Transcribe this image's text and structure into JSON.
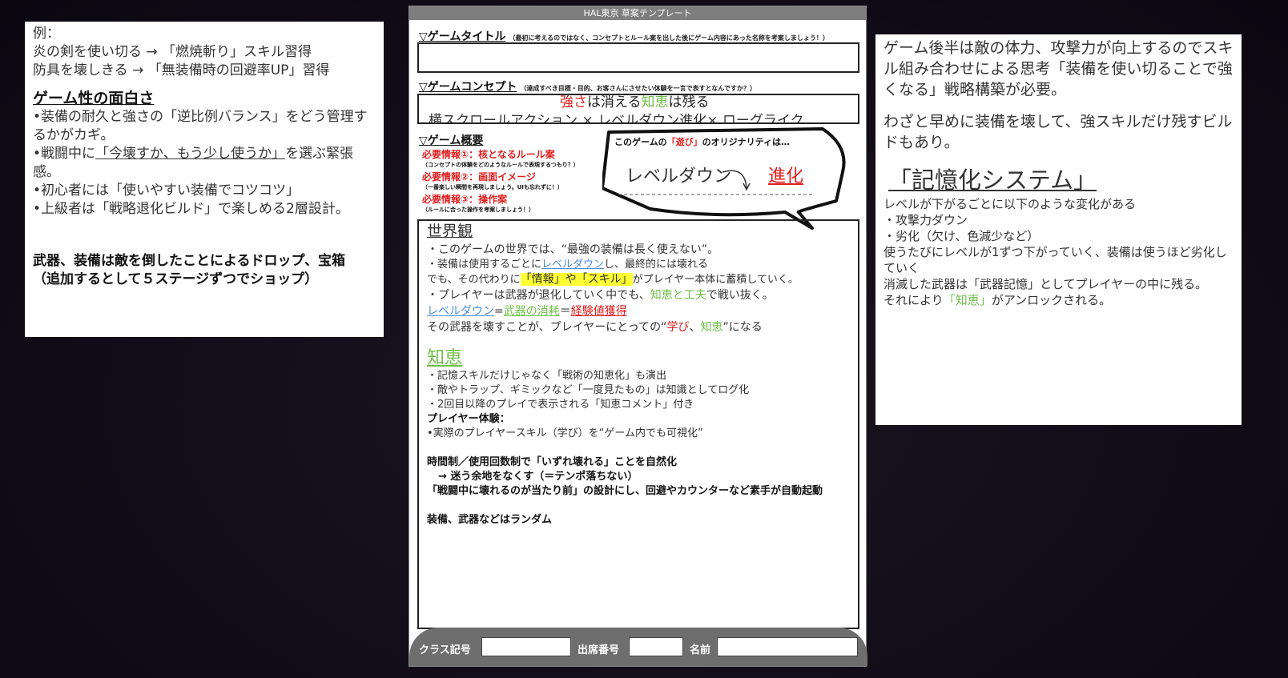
{
  "left_note": {
    "example_label": "例：",
    "example_1": "炎の剣を使い切る → 「燃焼斬り」スキル習得",
    "example_2": "防具を壊しきる → 「無装備時の回避率UP」習得",
    "heading": "ゲーム性の面白さ",
    "bullet_1": "•装備の耐久と強さの「逆比例バランス」をどう管理するかがカギ。",
    "bullet_2_pre": "•戦闘中に",
    "bullet_2_u": "「今壊すか、もう少し使うか」",
    "bullet_2_post": "を選ぶ緊張感。",
    "bullet_3": "•初心者には「使いやすい装備でコツコツ」",
    "bullet_4": "•上級者は「戦略退化ビルド」で楽しめる2層設計。",
    "bold_1": "武器、装備は敵を倒したことによるドロップ、宝箱",
    "bold_2": "（追加するとして５ステージずつでショップ）"
  },
  "template": {
    "header": "HAL東京 草案テンプレート",
    "title_label": "▽ゲームタイトル",
    "title_note": "（最初に考えるのではなく、コンセプトとルール案を出した後にゲーム内容にあった名称を考案しましょう！）",
    "concept_label": "▽ゲームコンセプト",
    "concept_note": "（達成すべき目標・目的、お客さんにさせたい体験を一言で表すとなんですか？）",
    "concept_1a": "強さ",
    "concept_1b": "は消える",
    "concept_1c": "知恵",
    "concept_1d": "は残る",
    "concept_2": "横スクロールアクション × レベルダウン進化× ローグライク",
    "overview_label": "▽ゲーム概要",
    "req1": "必要情報①：核となるルール案",
    "req1_sub": "（コンセプトの体験をどのようなルールで表現するつもり？）",
    "req2": "必要情報②：画面イメージ",
    "req2_sub": "（一番楽しい瞬間を再現しましょう。UIも忘れずに！）",
    "req3": "必要情報③：操作案",
    "req3_sub": "（ルールに合った操作を考案しましょう！）",
    "bubble_pre": "このゲームの",
    "bubble_red": "「遊び」",
    "bubble_post": "のオリジナリティは…",
    "bubble_a": "レベルダウン",
    "bubble_b": "進化",
    "world_title": "世界観",
    "w1": "・このゲームの世界では、“最強の装備は長く使えない”。",
    "w2a": "・装備は使用するごとに",
    "w2b": "レベルダウン",
    "w2c": "し、最終的には壊れる",
    "w3a": "でも、その代わりに",
    "w3b": "「情報」や「スキル」",
    "w3c": "がプレイヤー本体に蓄積していく。",
    "w4a": "・プレイヤーは武器が退化していく中でも、",
    "w4b": "知恵と工夫",
    "w4c": "で戦い抜く。",
    "w5a": "レベルダウン",
    "w5b": "=",
    "w5c": "武器の消耗",
    "w5d": "＝",
    "w5e": "経験値獲得",
    "w6a": "その武器を壊すことが、プレイヤーにとっての“",
    "w6b": "学び",
    "w6c": "、",
    "w6d": "知恵",
    "w6e": "”になる",
    "wisdom_title": "知恵",
    "k1": "・記憶スキルだけじゃなく「戦術の知恵化」も演出",
    "k2": "・敵やトラップ、ギミックなど「一度見たもの」は知識としてログ化",
    "k3": "・2回目以降のプレイで表示される「知恵コメント」付き",
    "px_label": "プレイヤー体験：",
    "px1": "•実際のプレイヤースキル（学び）を“ゲーム内でも可視化”",
    "t1": "時間制／使用回数制で「いずれ壊れる」ことを自然化",
    "t2": "→ 迷う余地をなくす（＝テンポ落ちない）",
    "t3": "「戦闘中に壊れるのが当たり前」の設計にし、回避やカウンターなど素手が自動起動",
    "t4": "装備、武器などはランダム",
    "f_class": "クラス記号",
    "f_number": "出席番号",
    "f_name": "名前"
  },
  "right_note": {
    "p1": "ゲーム後半は敵の体力、攻撃力が向上するのでスキル組み合わせによる思考「装備を使い切ることで強くなる」戦略構築が必要。",
    "p2": "わざと早めに装備を壊して、強スキルだけ残すビルドもあり。",
    "heading": "「記憶化システム」",
    "l1": "レベルが下がるごとに以下のような変化がある",
    "l2": "・攻撃力ダウン",
    "l3": "・劣化（欠け、色減少など）",
    "l4": "使うたびにレベルが1ずつ下がっていく、装備は使うほど劣化していく",
    "l5": "消滅した武器は「武器記憶」としてプレイヤーの中に残る。",
    "l6a": "それにより",
    "l6b": "「知恵」",
    "l6c": "がアンロックされる。"
  }
}
